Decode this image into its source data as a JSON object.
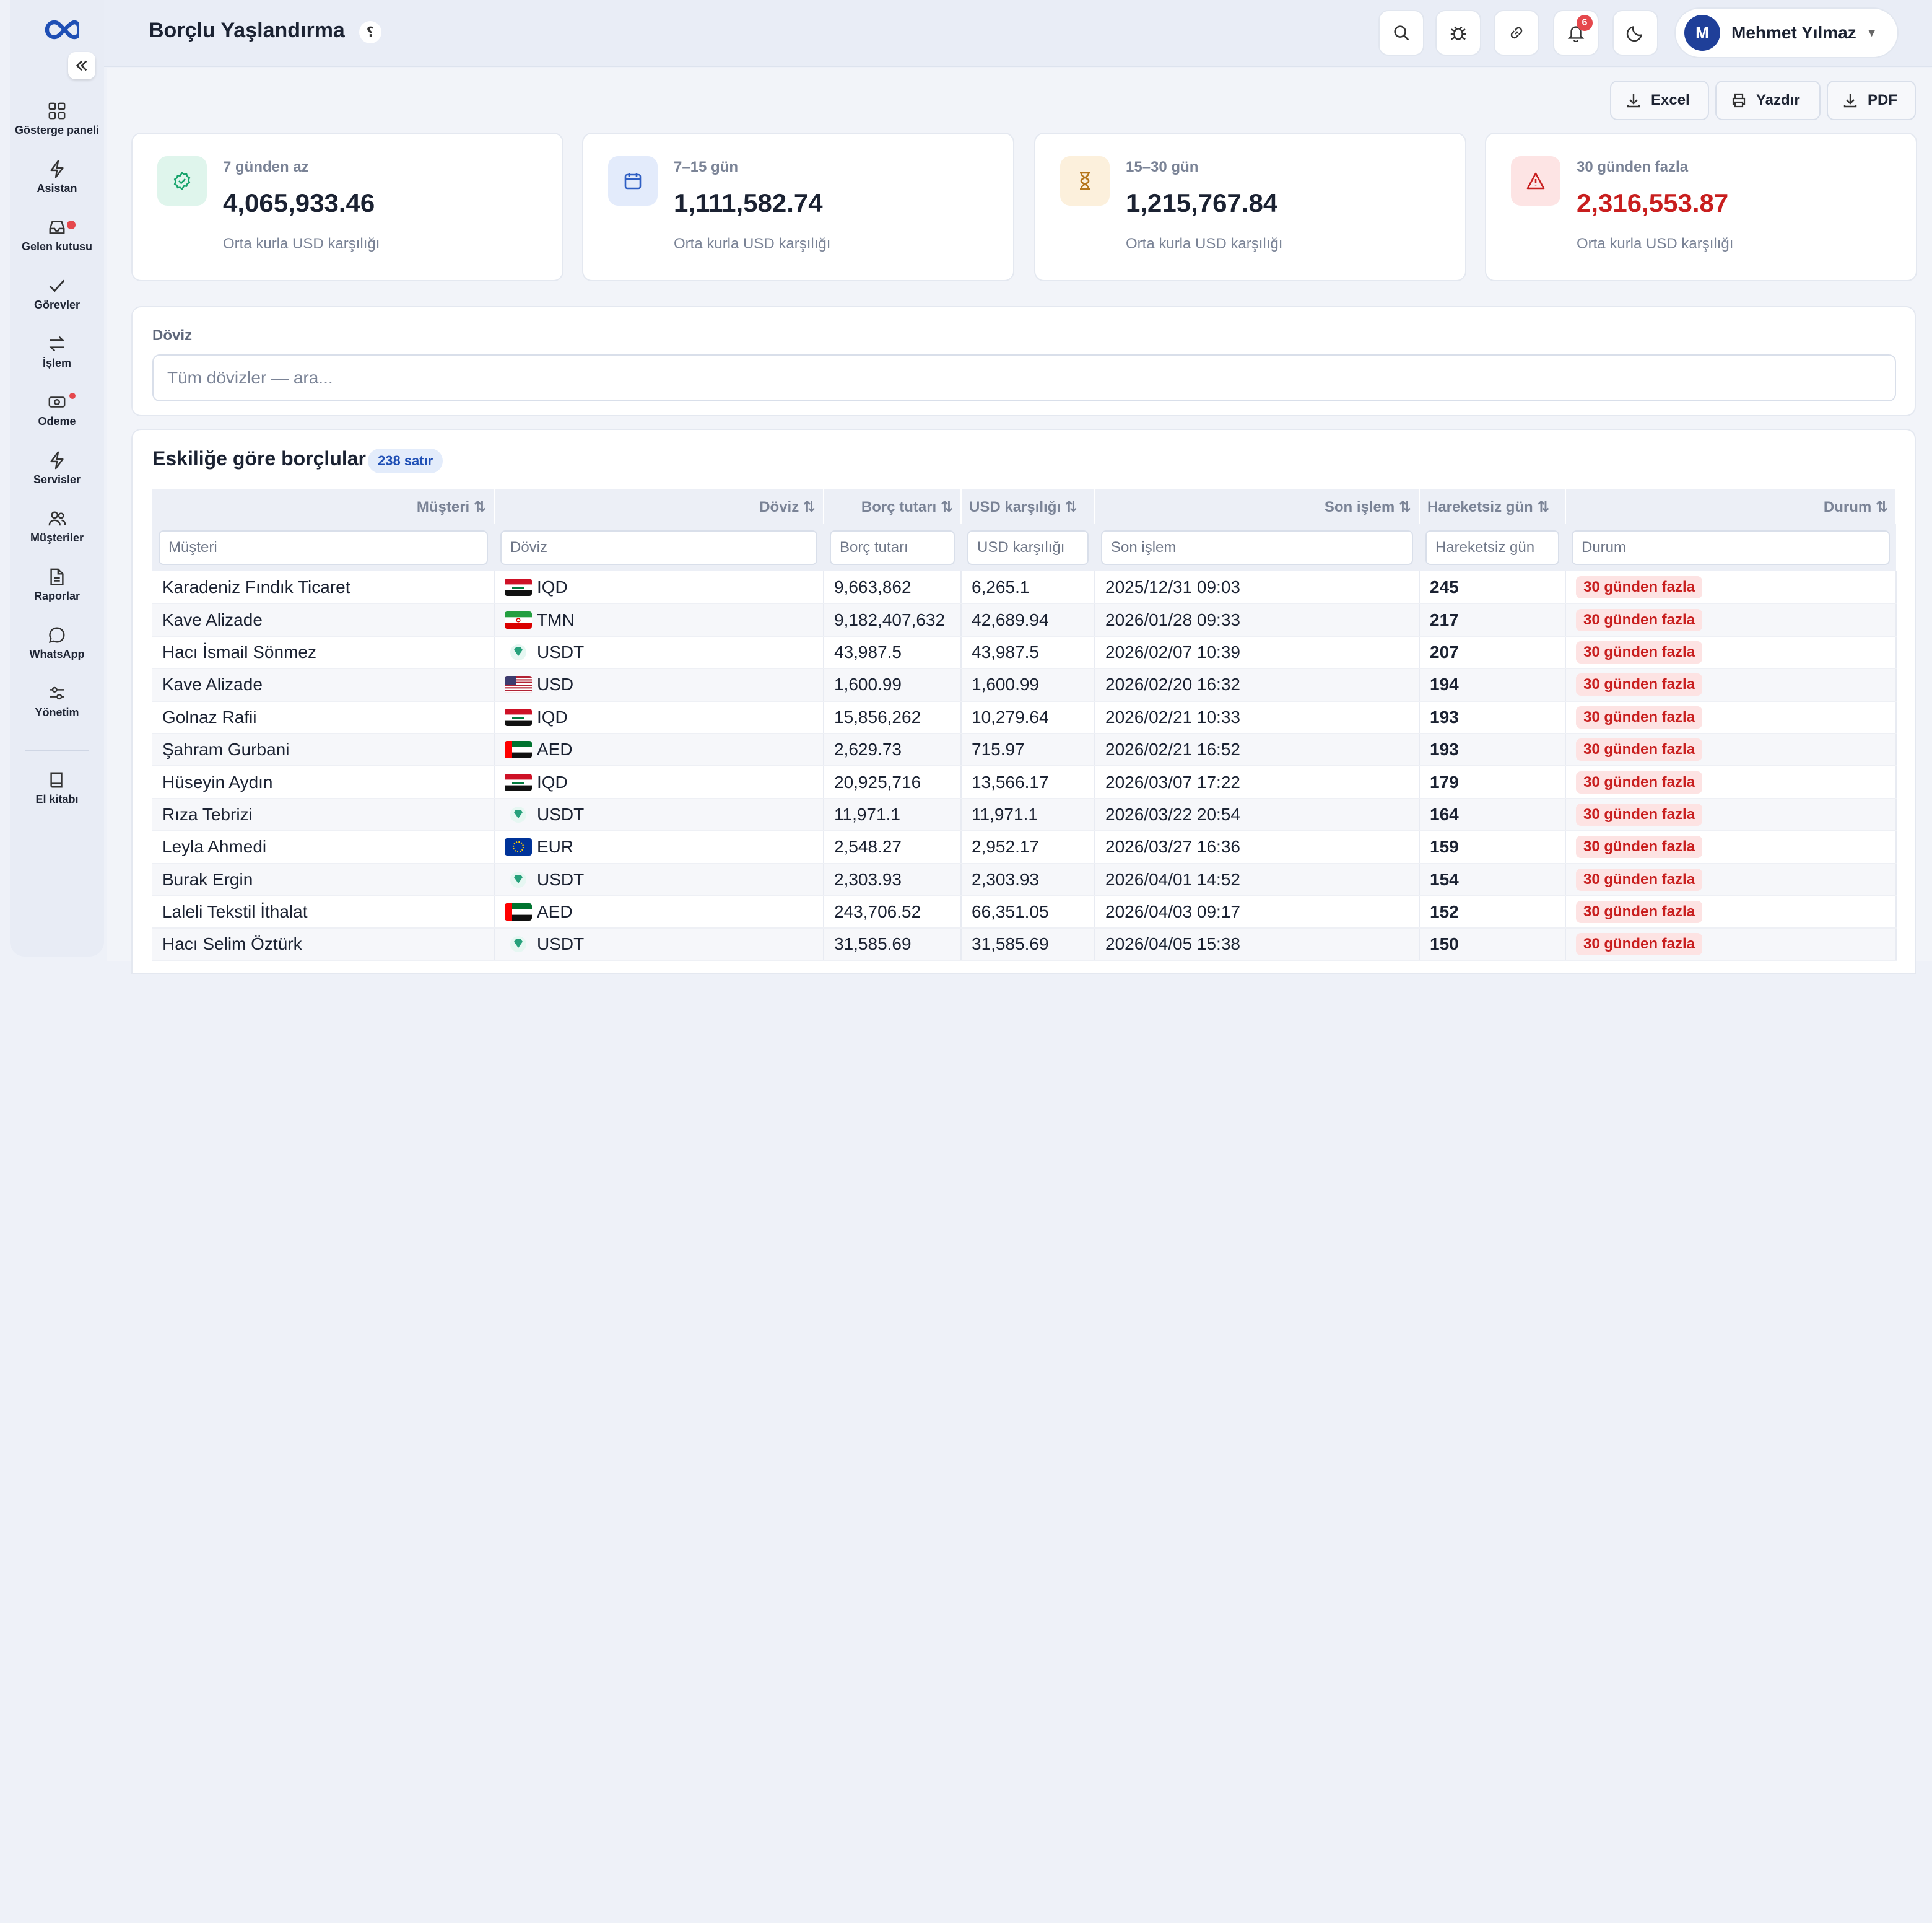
{
  "header": {
    "title": "Borçlu Yaşlandırma",
    "help_label": "؟",
    "notif_count": "6",
    "user": {
      "initial": "M",
      "name": "Mehmet Yılmaz"
    }
  },
  "sidebar": {
    "items": [
      {
        "label": "Gösterge paneli",
        "icon": "grid-icon"
      },
      {
        "label": "Asistan",
        "icon": "bolt-icon"
      },
      {
        "label": "Gelen kutusu",
        "icon": "inbox-icon"
      },
      {
        "label": "Görevler",
        "icon": "check-icon"
      },
      {
        "label": "İşlem",
        "icon": "swap-icon"
      },
      {
        "label": "Odeme",
        "icon": "cash-icon"
      },
      {
        "label": "Servisler",
        "icon": "bolt-icon"
      },
      {
        "label": "Müşteriler",
        "icon": "users-icon"
      },
      {
        "label": "Raporlar",
        "icon": "file-icon"
      },
      {
        "label": "WhatsApp",
        "icon": "chat-icon"
      },
      {
        "label": "Yönetim",
        "icon": "sliders-icon"
      }
    ],
    "handbook": "El kitabı"
  },
  "toolbar": {
    "excel": "Excel",
    "print": "Yazdır",
    "pdf": "PDF"
  },
  "cards": [
    {
      "label": "7 günden az",
      "value": "4,065,933.46",
      "sub": "Orta kurla USD karşılığı",
      "color": "#15a36b"
    },
    {
      "label": "7–15 gün",
      "value": "1,111,582.74",
      "sub": "Orta kurla USD karşılığı",
      "color": "#2f5fc4"
    },
    {
      "label": "15–30 gün",
      "value": "1,215,767.84",
      "sub": "Orta kurla USD karşılığı",
      "color": "#b5761b"
    },
    {
      "label": "30 günden fazla",
      "value": "2,316,553.87",
      "sub": "Orta kurla USD karşılığı",
      "color": "#c81e1e"
    }
  ],
  "filter": {
    "label": "Döviz",
    "placeholder": "Tüm dövizler — ara..."
  },
  "table": {
    "title": "Eskiliğe göre borçlular",
    "row_count": "238 satır",
    "columns": [
      "Müşteri ⇅",
      "Döviz ⇅",
      "Borç tutarı ⇅",
      "USD karşılığı ⇅",
      "Son işlem ⇅",
      "Hareketsiz gün ⇅",
      "Durum ⇅"
    ],
    "filters": [
      "Müşteri",
      "Döviz",
      "Borç tutarı",
      "USD karşılığı",
      "Son işlem",
      "Hareketsiz gün",
      "Durum"
    ],
    "rows": [
      {
        "customer": "Karadeniz Fındık Ticaret",
        "flag": "iq",
        "currency": "IQD",
        "debt": "9,663,862",
        "usd": "6,265.1",
        "last": "2025/12/31 09:03",
        "days": "245",
        "status": "30 günden fazla"
      },
      {
        "customer": "Kave Alizade",
        "flag": "ir",
        "currency": "TMN",
        "debt": "9,182,407,632",
        "usd": "42,689.94",
        "last": "2026/01/28 09:33",
        "days": "217",
        "status": "30 günden fazla"
      },
      {
        "customer": "Hacı İsmail Sönmez",
        "flag": "usdt",
        "currency": "USDT",
        "debt": "43,987.5",
        "usd": "43,987.5",
        "last": "2026/02/07 10:39",
        "days": "207",
        "status": "30 günden fazla"
      },
      {
        "customer": "Kave Alizade",
        "flag": "us",
        "currency": "USD",
        "debt": "1,600.99",
        "usd": "1,600.99",
        "last": "2026/02/20 16:32",
        "days": "194",
        "status": "30 günden fazla"
      },
      {
        "customer": "Golnaz Rafii",
        "flag": "iq",
        "currency": "IQD",
        "debt": "15,856,262",
        "usd": "10,279.64",
        "last": "2026/02/21 10:33",
        "days": "193",
        "status": "30 günden fazla"
      },
      {
        "customer": "Şahram Gurbani",
        "flag": "ae",
        "currency": "AED",
        "debt": "2,629.73",
        "usd": "715.97",
        "last": "2026/02/21 16:52",
        "days": "193",
        "status": "30 günden fazla"
      },
      {
        "customer": "Hüseyin Aydın",
        "flag": "iq",
        "currency": "IQD",
        "debt": "20,925,716",
        "usd": "13,566.17",
        "last": "2026/03/07 17:22",
        "days": "179",
        "status": "30 günden fazla"
      },
      {
        "customer": "Rıza Tebrizi",
        "flag": "usdt",
        "currency": "USDT",
        "debt": "11,971.1",
        "usd": "11,971.1",
        "last": "2026/03/22 20:54",
        "days": "164",
        "status": "30 günden fazla"
      },
      {
        "customer": "Leyla Ahmedi",
        "flag": "eu",
        "currency": "EUR",
        "debt": "2,548.27",
        "usd": "2,952.17",
        "last": "2026/03/27 16:36",
        "days": "159",
        "status": "30 günden fazla"
      },
      {
        "customer": "Burak Ergin",
        "flag": "usdt",
        "currency": "USDT",
        "debt": "2,303.93",
        "usd": "2,303.93",
        "last": "2026/04/01 14:52",
        "days": "154",
        "status": "30 günden fazla"
      },
      {
        "customer": "Laleli Tekstil İthalat",
        "flag": "ae",
        "currency": "AED",
        "debt": "243,706.52",
        "usd": "66,351.05",
        "last": "2026/04/03 09:17",
        "days": "152",
        "status": "30 günden fazla"
      },
      {
        "customer": "Hacı Selim Öztürk",
        "flag": "usdt",
        "currency": "USDT",
        "debt": "31,585.69",
        "usd": "31,585.69",
        "last": "2026/04/05 15:38",
        "days": "150",
        "status": "30 günden fazla"
      }
    ]
  }
}
